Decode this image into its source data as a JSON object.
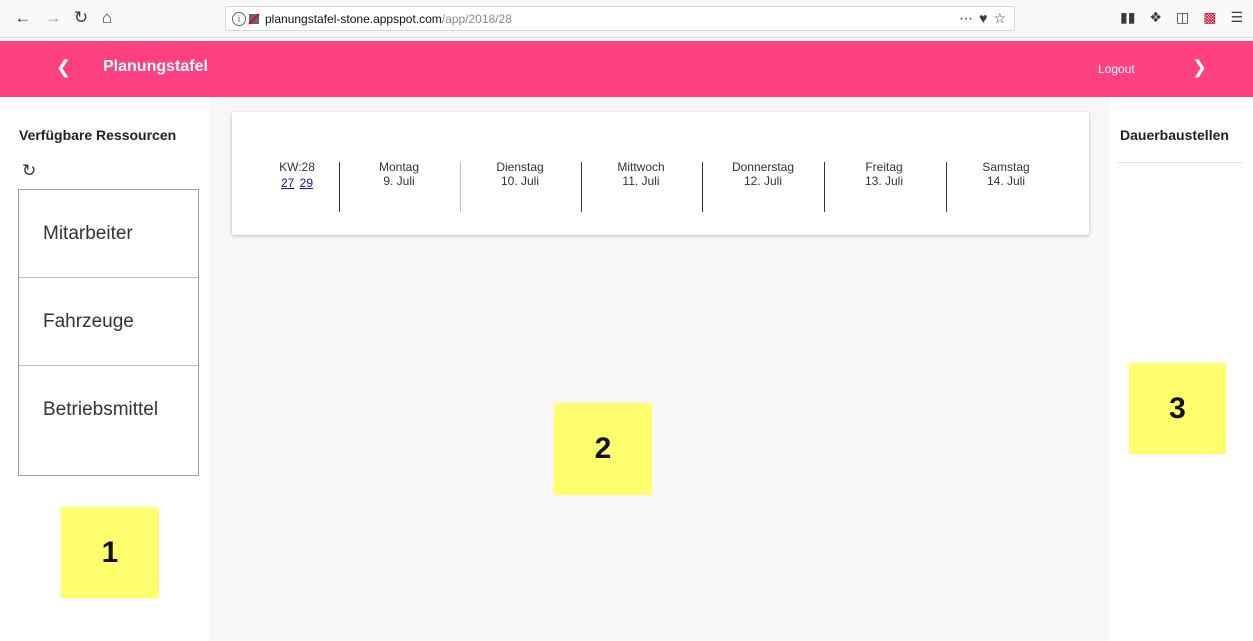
{
  "browser": {
    "url_host": "planungstafel-stone.appspot.com",
    "url_path": "/app/2018/28"
  },
  "app_bar": {
    "title": "Planungstafel",
    "logout": "Logout"
  },
  "left_panel": {
    "title": "Verfügbare Ressourcen",
    "items": [
      "Mitarbeiter",
      "Fahrzeuge",
      "Betriebsmittel"
    ]
  },
  "week": {
    "kw_label": "KW:28",
    "prev_week": "27",
    "next_week": "29",
    "days": [
      {
        "name": "Montag",
        "date": "9. Juli"
      },
      {
        "name": "Dienstag",
        "date": "10. Juli"
      },
      {
        "name": "Mittwoch",
        "date": "11. Juli"
      },
      {
        "name": "Donnerstag",
        "date": "12. Juli"
      },
      {
        "name": "Freitag",
        "date": "13. Juli"
      },
      {
        "name": "Samstag",
        "date": "14. Juli"
      }
    ]
  },
  "right_panel": {
    "title": "Dauerbaustellen"
  },
  "annotations": [
    "1",
    "2",
    "3"
  ],
  "colors": {
    "app_bar": "#ff4081",
    "annotation": "#ffff6e"
  }
}
